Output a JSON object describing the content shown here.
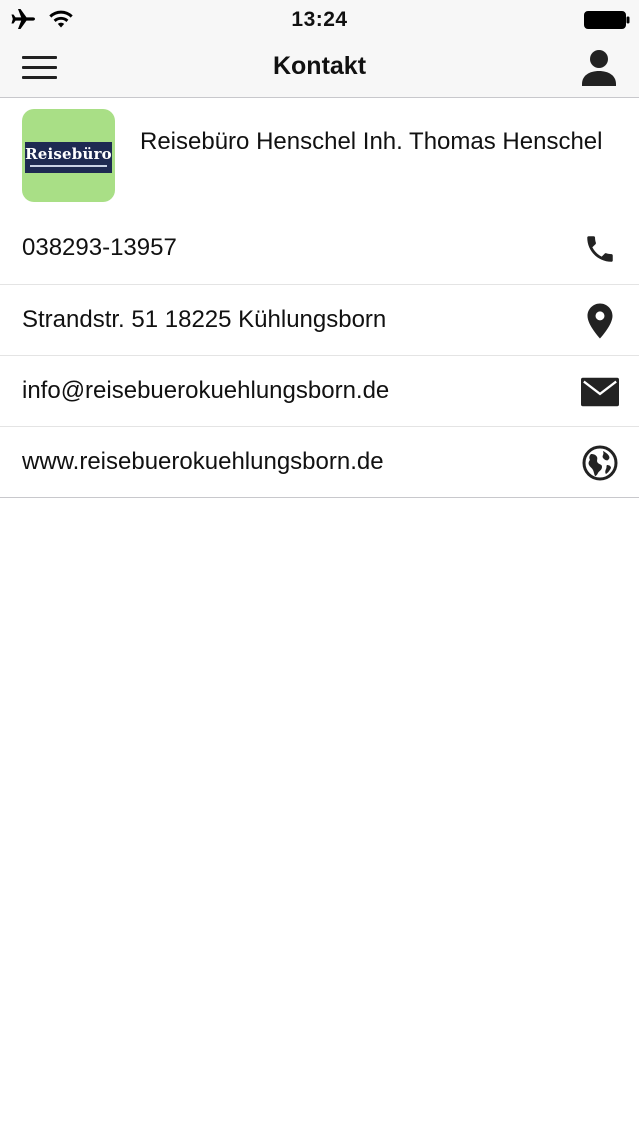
{
  "status_bar": {
    "time": "13:24",
    "icons": [
      "airplane-icon",
      "wifi-icon",
      "battery-icon"
    ]
  },
  "nav": {
    "title": "Kontakt",
    "left_icon": "menu-icon",
    "right_icon": "user-icon"
  },
  "company": {
    "name": "Reisebüro Henschel Inh. Thomas Henschel",
    "logo_text": "Reisebüro",
    "logo_color": "#a9df86"
  },
  "contact_rows": [
    {
      "value": "038293-13957",
      "icon": "phone-icon"
    },
    {
      "value": "Strandstr. 51 18225 Kühlungsborn",
      "icon": "location-pin-icon"
    },
    {
      "value": "info@reisebuerokuehlungsborn.de",
      "icon": "mail-icon"
    },
    {
      "value": "www.reisebuerokuehlungsborn.de",
      "icon": "globe-icon"
    }
  ]
}
